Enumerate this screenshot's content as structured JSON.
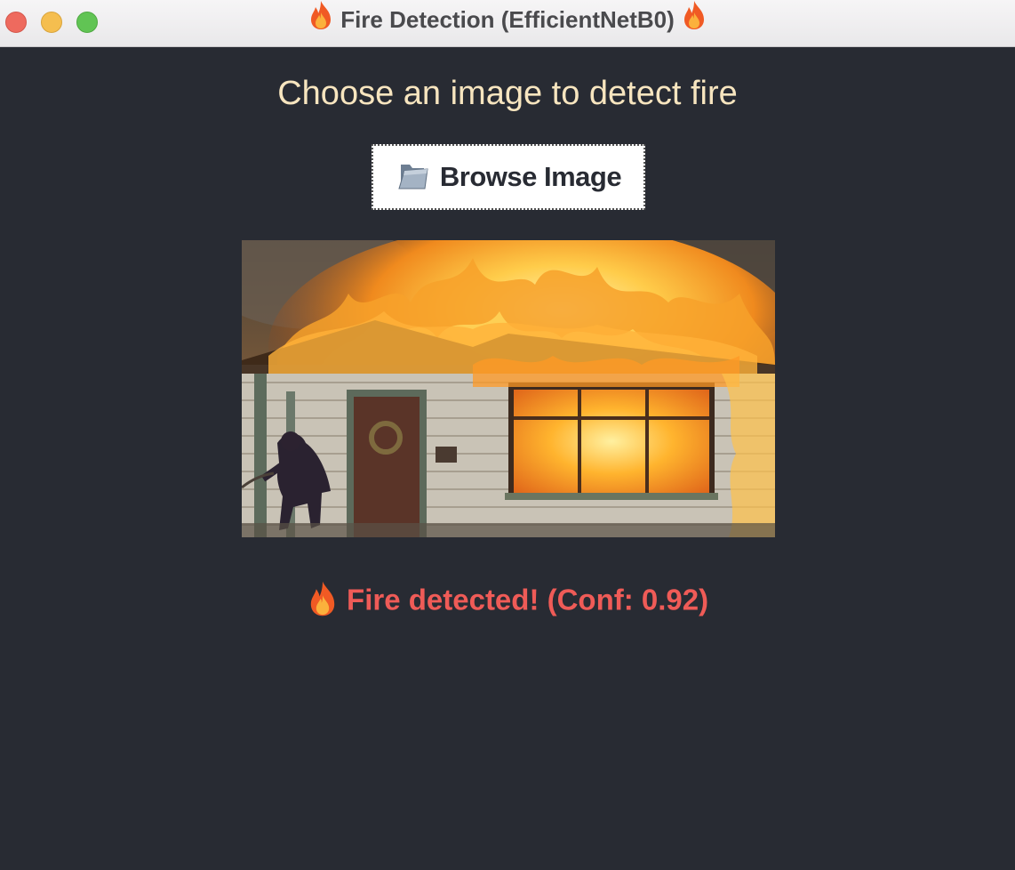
{
  "window": {
    "title": "Fire Detection (EfficientNetB0)",
    "title_icon": "fire-emoji"
  },
  "main": {
    "heading": "Choose an image to detect fire",
    "browse_button": {
      "label": "Browse Image",
      "icon": "folder-icon"
    },
    "preview": {
      "alt": "Burning house with firefighter holding hose"
    },
    "result": {
      "text": "Fire detected! (Conf: 0.92)",
      "icon": "fire-emoji",
      "color": "#ef5b57"
    }
  },
  "colors": {
    "background": "#282b33",
    "heading": "#f7e5bf",
    "alert": "#ef5b57"
  }
}
